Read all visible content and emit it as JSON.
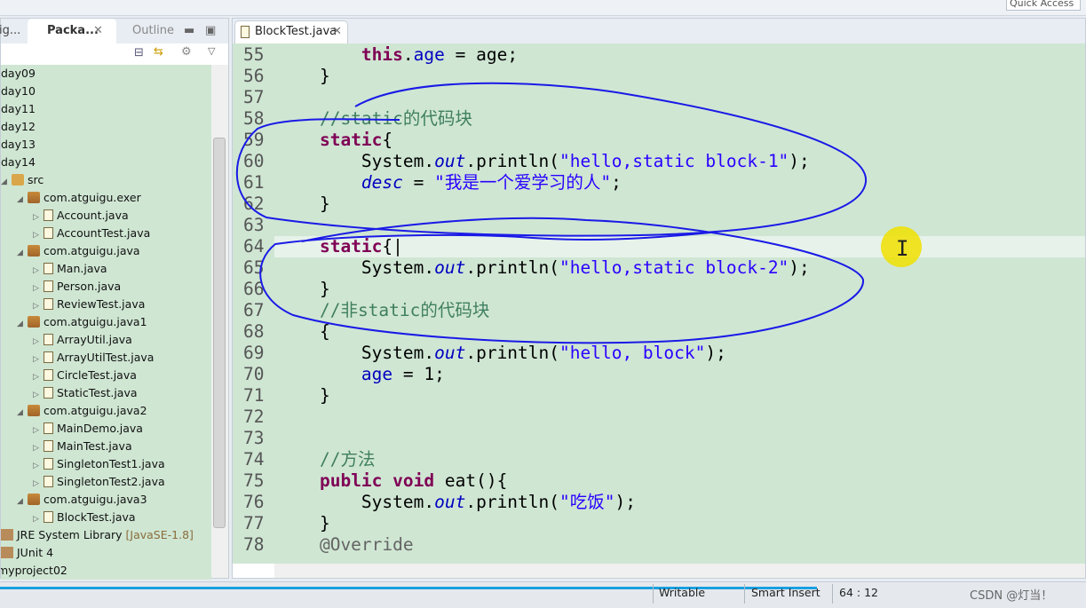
{
  "toolbar": {
    "quick_access": "Quick Access"
  },
  "left_panel": {
    "tabs": [
      {
        "label": "ig..."
      },
      {
        "label": "Packa...",
        "active": true
      },
      {
        "label": "Outline"
      }
    ],
    "tree": [
      {
        "label": "day09",
        "level": 0,
        "icon": "none"
      },
      {
        "label": "day10",
        "level": 0,
        "icon": "none"
      },
      {
        "label": "day11",
        "level": 0,
        "icon": "none"
      },
      {
        "label": "day12",
        "level": 0,
        "icon": "none"
      },
      {
        "label": "day13",
        "level": 0,
        "icon": "none"
      },
      {
        "label": "day14",
        "level": 0,
        "icon": "none"
      },
      {
        "label": "src",
        "level": 0,
        "icon": "src",
        "twisty": "open"
      },
      {
        "label": "com.atguigu.exer",
        "level": 1,
        "icon": "pkg",
        "twisty": "open"
      },
      {
        "label": "Account.java",
        "level": 2,
        "icon": "java",
        "twisty": "closed"
      },
      {
        "label": "AccountTest.java",
        "level": 2,
        "icon": "java",
        "twisty": "closed"
      },
      {
        "label": "com.atguigu.java",
        "level": 1,
        "icon": "pkg",
        "twisty": "open"
      },
      {
        "label": "Man.java",
        "level": 2,
        "icon": "java",
        "twisty": "closed"
      },
      {
        "label": "Person.java",
        "level": 2,
        "icon": "java",
        "twisty": "closed"
      },
      {
        "label": "ReviewTest.java",
        "level": 2,
        "icon": "java",
        "twisty": "closed"
      },
      {
        "label": "com.atguigu.java1",
        "level": 1,
        "icon": "pkg",
        "twisty": "open"
      },
      {
        "label": "ArrayUtil.java",
        "level": 2,
        "icon": "java",
        "twisty": "closed"
      },
      {
        "label": "ArrayUtilTest.java",
        "level": 2,
        "icon": "java",
        "twisty": "closed"
      },
      {
        "label": "CircleTest.java",
        "level": 2,
        "icon": "java",
        "twisty": "closed"
      },
      {
        "label": "StaticTest.java",
        "level": 2,
        "icon": "java",
        "twisty": "closed"
      },
      {
        "label": "com.atguigu.java2",
        "level": 1,
        "icon": "pkg",
        "twisty": "open"
      },
      {
        "label": "MainDemo.java",
        "level": 2,
        "icon": "java",
        "twisty": "closed"
      },
      {
        "label": "MainTest.java",
        "level": 2,
        "icon": "java",
        "twisty": "closed"
      },
      {
        "label": "SingletonTest1.java",
        "level": 2,
        "icon": "java",
        "twisty": "closed"
      },
      {
        "label": "SingletonTest2.java",
        "level": 2,
        "icon": "java",
        "twisty": "closed"
      },
      {
        "label": "com.atguigu.java3",
        "level": 1,
        "icon": "pkg",
        "twisty": "open"
      },
      {
        "label": "BlockTest.java",
        "level": 2,
        "icon": "java",
        "twisty": "closed"
      },
      {
        "label": "JRE System Library",
        "suffix": "[JavaSE-1.8]",
        "level": 0,
        "icon": "lib"
      },
      {
        "label": "JUnit 4",
        "level": 0,
        "icon": "lib"
      },
      {
        "label": "myproject02",
        "level": -1,
        "icon": "none"
      }
    ]
  },
  "editor": {
    "tab": "BlockTest.java",
    "current_line": 64,
    "lines": [
      {
        "n": "55",
        "s": [
          [
            "        ",
            ""
          ],
          [
            "this",
            "kw"
          ],
          [
            ".",
            ""
          ],
          [
            "age",
            "var"
          ],
          [
            " = age;",
            ""
          ]
        ]
      },
      {
        "n": "56",
        "s": [
          [
            "    }",
            ""
          ]
        ]
      },
      {
        "n": "57",
        "s": []
      },
      {
        "n": "58",
        "s": [
          [
            "    //static的代码块",
            "cm"
          ]
        ]
      },
      {
        "n": "59",
        "s": [
          [
            "    ",
            ""
          ],
          [
            "static",
            "kw"
          ],
          [
            "{",
            ""
          ]
        ]
      },
      {
        "n": "60",
        "s": [
          [
            "        System.",
            ""
          ],
          [
            "out",
            "fld"
          ],
          [
            ".println(",
            ""
          ],
          [
            "\"hello,static block-1\"",
            "str"
          ],
          [
            ");",
            ""
          ]
        ]
      },
      {
        "n": "61",
        "s": [
          [
            "        ",
            ""
          ],
          [
            "desc",
            "fld"
          ],
          [
            " = ",
            ""
          ],
          [
            "\"我是一个爱学习的人\"",
            "str"
          ],
          [
            ";",
            ""
          ]
        ]
      },
      {
        "n": "62",
        "s": [
          [
            "    }",
            ""
          ]
        ]
      },
      {
        "n": "63",
        "s": []
      },
      {
        "n": "64",
        "s": [
          [
            "    ",
            ""
          ],
          [
            "static",
            "kw"
          ],
          [
            "{|",
            ""
          ]
        ]
      },
      {
        "n": "65",
        "s": [
          [
            "        System.",
            ""
          ],
          [
            "out",
            "fld"
          ],
          [
            ".println(",
            ""
          ],
          [
            "\"hello,static block-2\"",
            "str"
          ],
          [
            ");",
            ""
          ]
        ]
      },
      {
        "n": "66",
        "s": [
          [
            "    }",
            ""
          ]
        ]
      },
      {
        "n": "67",
        "s": [
          [
            "    //非static的代码块",
            "cm"
          ]
        ]
      },
      {
        "n": "68",
        "s": [
          [
            "    {",
            ""
          ]
        ]
      },
      {
        "n": "69",
        "s": [
          [
            "        System.",
            ""
          ],
          [
            "out",
            "fld"
          ],
          [
            ".println(",
            ""
          ],
          [
            "\"hello, block\"",
            "str"
          ],
          [
            ");",
            ""
          ]
        ]
      },
      {
        "n": "70",
        "s": [
          [
            "        ",
            ""
          ],
          [
            "age",
            "var"
          ],
          [
            " = 1;",
            ""
          ]
        ]
      },
      {
        "n": "71",
        "s": [
          [
            "    }",
            ""
          ]
        ]
      },
      {
        "n": "72",
        "s": []
      },
      {
        "n": "73",
        "s": []
      },
      {
        "n": "74",
        "s": [
          [
            "    //方法",
            "cm"
          ]
        ]
      },
      {
        "n": "75",
        "s": [
          [
            "    ",
            ""
          ],
          [
            "public",
            "kw"
          ],
          [
            " ",
            ""
          ],
          [
            "void",
            "kw"
          ],
          [
            " eat(){",
            ""
          ]
        ]
      },
      {
        "n": "76",
        "s": [
          [
            "        System.",
            ""
          ],
          [
            "out",
            "fld"
          ],
          [
            ".println(",
            ""
          ],
          [
            "\"吃饭\"",
            "str"
          ],
          [
            ");",
            ""
          ]
        ]
      },
      {
        "n": "77",
        "s": [
          [
            "    }",
            ""
          ]
        ]
      },
      {
        "n": "78",
        "s": [
          [
            "    @Override",
            "ann"
          ]
        ]
      }
    ]
  },
  "status": {
    "writable": "Writable",
    "insert_mode": "Smart Insert",
    "position": "64 : 12",
    "watermark": "CSDN @灯当！"
  },
  "colors": {
    "annotation_ink": "#1a1ae6",
    "editor_bg": "#cfe6d3",
    "cursor_highlight": "#f0e000"
  }
}
